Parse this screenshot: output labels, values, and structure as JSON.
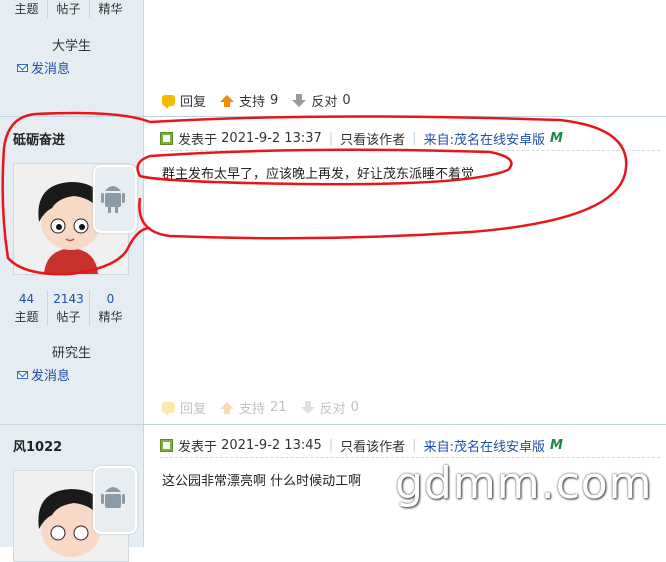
{
  "post1": {
    "stats": [
      {
        "num": "",
        "label": "主题"
      },
      {
        "num": "",
        "label": "帖子"
      },
      {
        "num": "",
        "label": "精华"
      }
    ],
    "rank": "大学生",
    "send_msg": "发消息",
    "actions": {
      "reply": "回复",
      "support": "支持",
      "support_count": "9",
      "oppose": "反对",
      "oppose_count": "0"
    }
  },
  "post2": {
    "username": "砥砺奋进",
    "posted_label": "发表于",
    "timestamp": "2021-9-2 13:37",
    "author_only": "只看该作者",
    "source": "来自:茂名在线安卓版",
    "content": "群主发布太早了，应该晚上再发，好让茂东派睡不着觉",
    "stats": [
      {
        "num": "44",
        "label": "主题"
      },
      {
        "num": "2143",
        "label": "帖子"
      },
      {
        "num": "0",
        "label": "精华"
      }
    ],
    "rank": "研究生",
    "send_msg": "发消息",
    "actions": {
      "reply": "回复",
      "support": "支持",
      "support_count": "21",
      "oppose": "反对",
      "oppose_count": "0"
    }
  },
  "post3": {
    "username": "风1022",
    "posted_label": "发表于",
    "timestamp": "2021-9-2 13:45",
    "author_only": "只看该作者",
    "source": "来自:茂名在线安卓版",
    "content": "这公园非常漂亮啊 什么时候动工啊"
  },
  "watermark": "gdmm.com",
  "colors": {
    "link": "#1f4fa5",
    "sidebar": "#e5edf2",
    "highlight": "#e8161a"
  }
}
